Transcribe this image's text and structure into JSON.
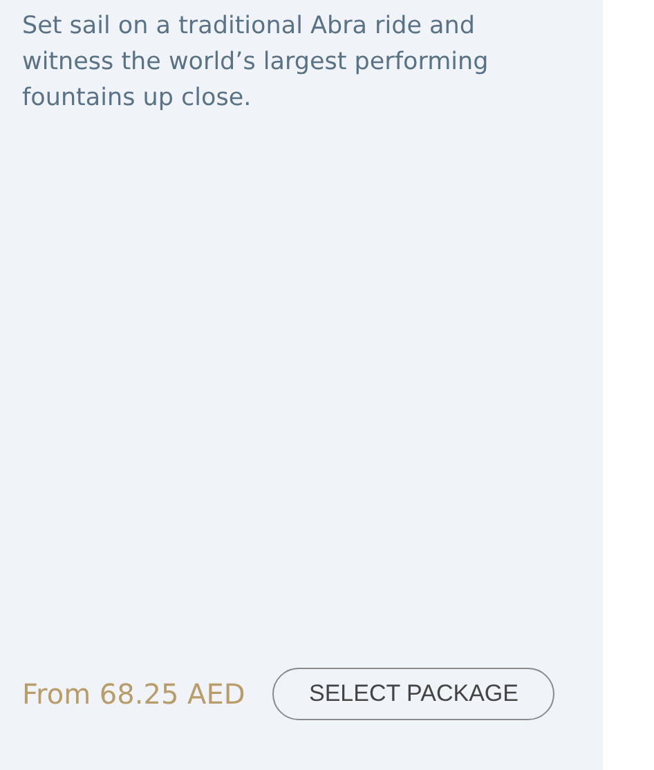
{
  "card": {
    "description": "Set sail on a traditional Abra ride and witness the world’s largest performing fountains up close.",
    "price": "From 68.25 AED",
    "button": "SELECT PACKAGE"
  }
}
